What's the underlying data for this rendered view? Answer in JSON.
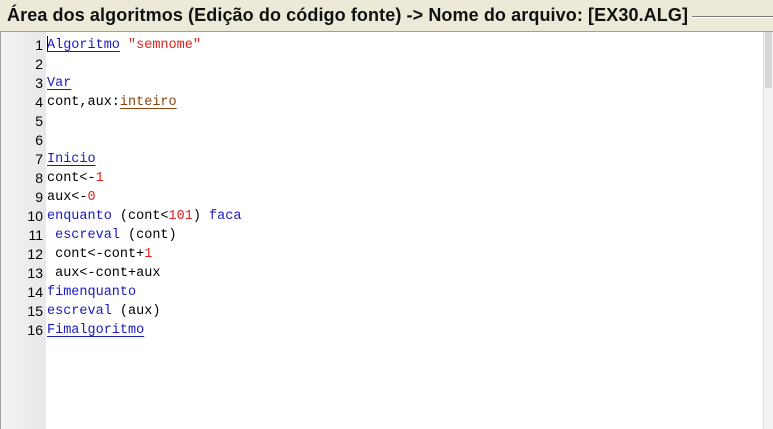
{
  "window": {
    "title": "Área dos algoritmos (Edição do código fonte) -> Nome do arquivo: [EX30.ALG]"
  },
  "editor": {
    "lines": [
      {
        "n": "1",
        "tokens": [
          {
            "t": "Algoritmo",
            "c": "kw-ul"
          },
          {
            "t": " "
          },
          {
            "t": "\"semnome\"",
            "c": "str"
          }
        ]
      },
      {
        "n": "2",
        "tokens": []
      },
      {
        "n": "3",
        "tokens": [
          {
            "t": "Var",
            "c": "kw-ul"
          }
        ]
      },
      {
        "n": "4",
        "tokens": [
          {
            "t": "cont,aux:"
          },
          {
            "t": "inteiro",
            "c": "type-ul"
          }
        ]
      },
      {
        "n": "5",
        "tokens": []
      },
      {
        "n": "6",
        "tokens": []
      },
      {
        "n": "7",
        "tokens": [
          {
            "t": "Inicio",
            "c": "kw-ul"
          }
        ]
      },
      {
        "n": "8",
        "tokens": [
          {
            "t": "cont<-"
          },
          {
            "t": "1",
            "c": "num"
          }
        ]
      },
      {
        "n": "9",
        "tokens": [
          {
            "t": "aux<-"
          },
          {
            "t": "0",
            "c": "num"
          }
        ]
      },
      {
        "n": "10",
        "tokens": [
          {
            "t": "enquanto",
            "c": "kw"
          },
          {
            "t": " (cont<"
          },
          {
            "t": "101",
            "c": "num"
          },
          {
            "t": ") "
          },
          {
            "t": "faca",
            "c": "kw"
          }
        ]
      },
      {
        "n": "11",
        "tokens": [
          {
            "t": " "
          },
          {
            "t": "escreval",
            "c": "kw"
          },
          {
            "t": " (cont)"
          }
        ]
      },
      {
        "n": "12",
        "tokens": [
          {
            "t": " cont<-cont+"
          },
          {
            "t": "1",
            "c": "num"
          }
        ]
      },
      {
        "n": "13",
        "tokens": [
          {
            "t": " aux<-cont+aux"
          }
        ]
      },
      {
        "n": "14",
        "tokens": [
          {
            "t": "fimenquanto",
            "c": "kw"
          }
        ]
      },
      {
        "n": "15",
        "tokens": [
          {
            "t": "escreval",
            "c": "kw"
          },
          {
            "t": " (aux)"
          }
        ]
      },
      {
        "n": "16",
        "tokens": [
          {
            "t": "Fimalgoritmo",
            "c": "kw-ul"
          }
        ]
      }
    ]
  }
}
